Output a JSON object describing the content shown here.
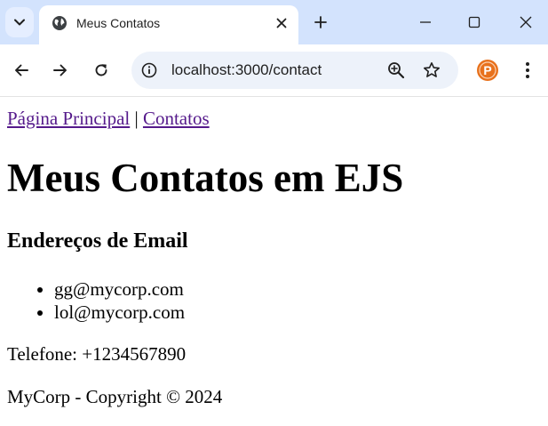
{
  "browser": {
    "tab_title": "Meus Contatos",
    "url": "localhost:3000/contact",
    "extension_letter": "P",
    "colors": {
      "tabstrip": "#d3e3fd",
      "omnibox": "#edf2fa",
      "extension": "#e8711c"
    },
    "icons": [
      "tab-search-icon",
      "globe-icon",
      "close-icon",
      "plus-icon",
      "minimize-icon",
      "maximize-icon",
      "window-close-icon",
      "back-arrow-icon",
      "forward-arrow-icon",
      "reload-icon",
      "info-icon",
      "zoom-icon",
      "star-icon",
      "extension-icon",
      "more-vert-icon"
    ]
  },
  "page": {
    "nav": {
      "home_link": "Página Principal",
      "separator": "|",
      "contacts_link": "Contatos"
    },
    "title": "Meus Contatos em EJS",
    "emails_heading": "Endereços de Email",
    "emails": [
      "gg@mycorp.com",
      "lol@mycorp.com"
    ],
    "phone": "Telefone: +1234567890",
    "footer": "MyCorp - Copyright © 2024",
    "link_color": "#551a8b"
  }
}
